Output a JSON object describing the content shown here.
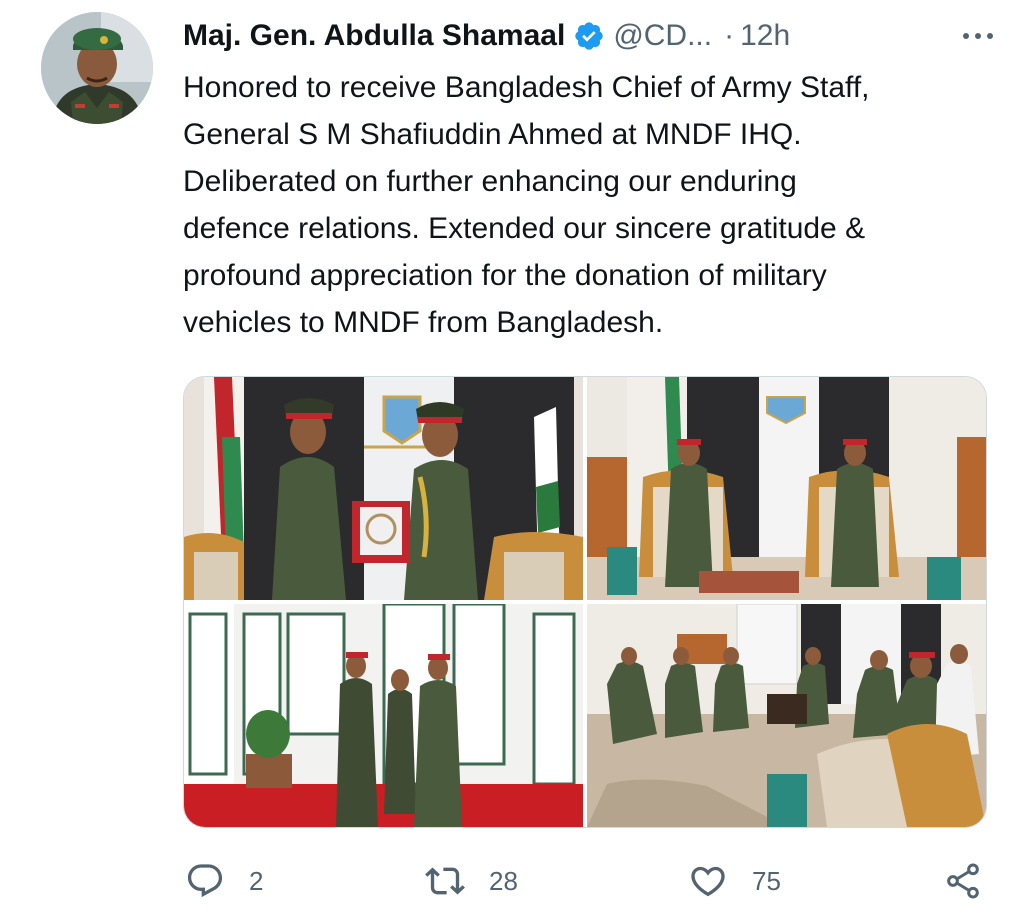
{
  "tweet": {
    "author_name": "Maj. Gen. Abdulla Shamaal",
    "handle": "@CD...",
    "separator": "·",
    "time": "12h",
    "verified": true,
    "text_lines": [
      "Honored to receive Bangladesh Chief of Army Staff,",
      "General S M Shafiuddin Ahmed at MNDF IHQ.",
      "Deliberated on further enhancing our enduring",
      "defence relations. Extended our sincere gratitude &",
      "profound appreciation for the donation of military",
      "vehicles to MNDF from Bangladesh."
    ],
    "media_count": 4
  },
  "actions": {
    "reply_count": "2",
    "retweet_count": "28",
    "like_count": "75"
  },
  "icons": {
    "verified": "verified-badge-icon",
    "more": "more-dots-icon",
    "reply": "reply-bubble-icon",
    "retweet": "retweet-icon",
    "like": "heart-icon",
    "share": "share-icon"
  },
  "colors": {
    "text_primary": "#0f1419",
    "text_secondary": "#536471",
    "verified_blue": "#1d9bf0",
    "border": "#cfd9de"
  }
}
